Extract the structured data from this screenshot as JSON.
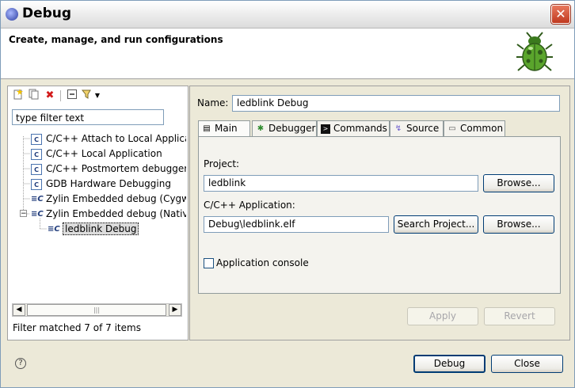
{
  "window": {
    "title": "Debug",
    "close_glyph": "✕"
  },
  "banner": {
    "text": "Create, manage, and run configurations",
    "icon": "bug-icon"
  },
  "left": {
    "filter_text": "type filter text",
    "tree": [
      {
        "label": "C/C++ Attach to Local Applica",
        "icon": "cpp-config-icon"
      },
      {
        "label": "C/C++ Local Application",
        "icon": "cpp-config-icon"
      },
      {
        "label": "C/C++ Postmortem debugger",
        "icon": "cpp-config-icon"
      },
      {
        "label": "GDB Hardware Debugging",
        "icon": "cpp-config-icon"
      },
      {
        "label": "Zylin Embedded debug (Cygwi",
        "icon": "zylin-icon"
      },
      {
        "label": "Zylin Embedded debug (Native",
        "icon": "zylin-icon",
        "expanded": true
      },
      {
        "label": "ledblink Debug",
        "icon": "zylin-config-icon",
        "selected": true
      }
    ],
    "status": "Filter matched 7 of 7 items"
  },
  "right": {
    "name_label": "Name:",
    "name_value": "ledblink Debug",
    "tabs": [
      {
        "label": "Main",
        "icon": "main-tab-icon"
      },
      {
        "label": "Debugger",
        "icon": "debugger-tab-icon"
      },
      {
        "label": "Commands",
        "icon": "commands-tab-icon"
      },
      {
        "label": "Source",
        "icon": "source-tab-icon"
      },
      {
        "label": "Common",
        "icon": "common-tab-icon"
      }
    ],
    "project_label": "Project:",
    "project_value": "ledblink",
    "browse_label": "Browse...",
    "app_label": "C/C++ Application:",
    "app_value": "Debug\\ledblink.elf",
    "search_label": "Search Project...",
    "console_label": "Application console",
    "apply_label": "Apply",
    "revert_label": "Revert"
  },
  "footer": {
    "debug_label": "Debug",
    "close_label": "Close",
    "help_glyph": "?"
  }
}
